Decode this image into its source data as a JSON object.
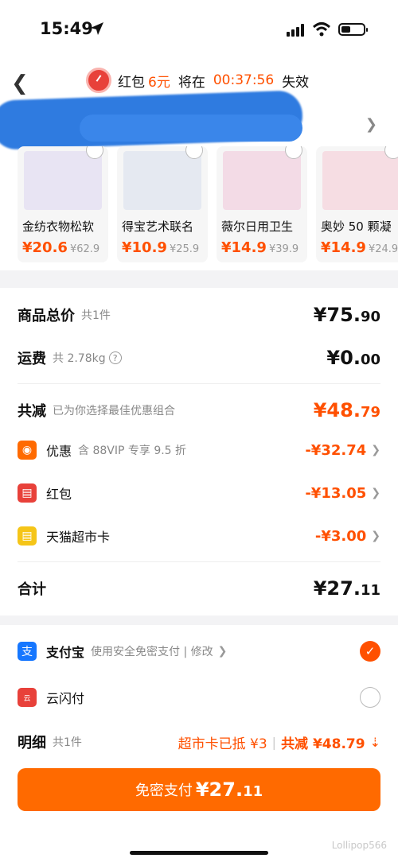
{
  "status_bar": {
    "time": "15:49"
  },
  "header": {
    "timer_prefix": "红包",
    "timer_amount": "6元",
    "timer_mid": "将在",
    "timer_time": "00:37:56",
    "timer_suffix": "失效"
  },
  "products": [
    {
      "name": "金纺衣物松软",
      "price": "¥20.6",
      "orig": "¥62.9",
      "color": "#e8e4f3"
    },
    {
      "name": "得宝艺术联名",
      "price": "¥10.9",
      "orig": "¥25.9",
      "color": "#e5e9f1"
    },
    {
      "name": "薇尔日用卫生",
      "price": "¥14.9",
      "orig": "¥39.9",
      "color": "#f3dbe6"
    },
    {
      "name": "奥妙 50 颗凝",
      "price": "¥14.9",
      "orig": "¥24.9",
      "color": "#f6dde3"
    }
  ],
  "summary": {
    "goods_label": "商品总价",
    "goods_count": "共1件",
    "goods_yuan": "¥75.",
    "goods_cents": "90",
    "ship_label": "运费",
    "ship_weight": "共 2.78kg",
    "ship_yuan": "¥0.",
    "ship_cents": "00",
    "reduce_label": "共减",
    "reduce_note": "已为你选择最佳优惠组合",
    "reduce_yuan": "¥48.",
    "reduce_cents": "79",
    "discount_label": "优惠",
    "discount_note": "含 88VIP 专享 9.5 折",
    "discount_value": "-¥32.74",
    "redpacket_label": "红包",
    "redpacket_value": "-¥13.05",
    "card_label": "天猫超市卡",
    "card_value": "-¥3.00",
    "total_label": "合计",
    "total_yuan": "¥27.",
    "total_cents": "11"
  },
  "payment": {
    "alipay_label": "支付宝",
    "alipay_note": "使用安全免密支付 | 修改",
    "unionpay_label": "云闪付",
    "detail_label": "明细",
    "detail_count": "共1件",
    "detail_card": "超市卡已抵 ¥3",
    "detail_reduce": "共减 ¥48.79",
    "pay_button_label": "免密支付",
    "pay_yuan": "¥27.",
    "pay_cents": "11"
  },
  "watermark": "Lollipop566",
  "colors": {
    "accent": "#ff5000",
    "alipay": "#1677ff",
    "redpacket": "#e8413a",
    "card": "#f5c518"
  }
}
